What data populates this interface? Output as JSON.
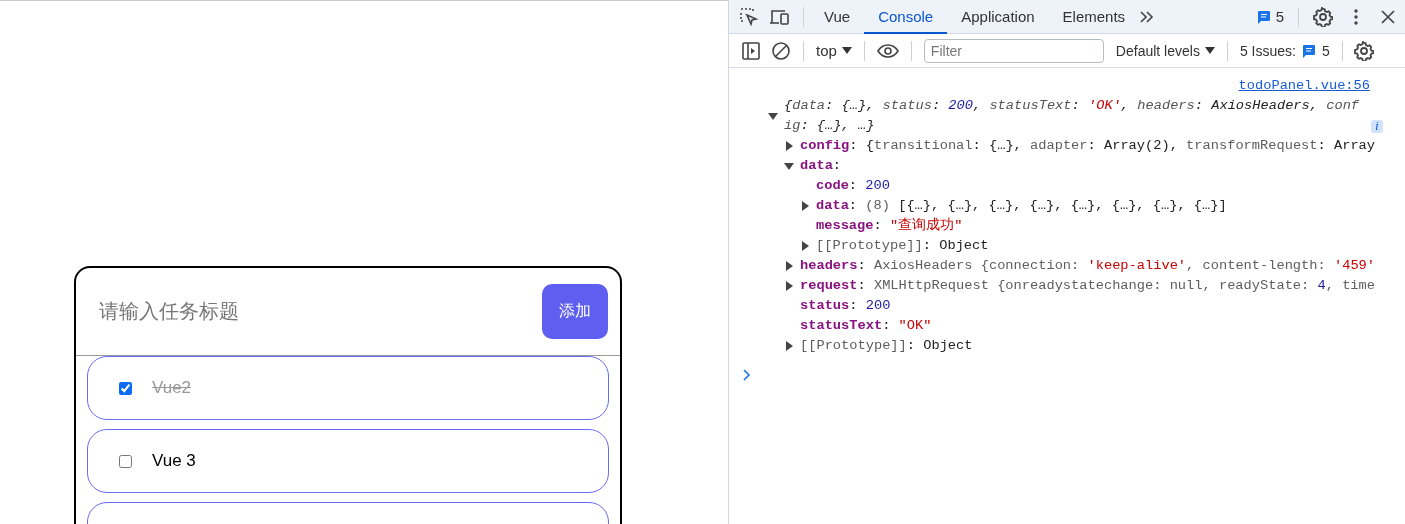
{
  "app": {
    "input": {
      "placeholder": "请输入任务标题"
    },
    "add_button": "添加",
    "todos": [
      {
        "kind": "task",
        "title": "Vue2",
        "checked": true
      },
      {
        "kind": "task",
        "title": "Vue 3",
        "checked": false
      },
      {
        "kind": "cut-off"
      }
    ]
  },
  "devtools": {
    "tabs": [
      {
        "label": "Vue",
        "selected": false
      },
      {
        "label": "Console",
        "selected": true
      },
      {
        "label": "Application",
        "selected": false
      },
      {
        "label": "Elements",
        "selected": false
      }
    ],
    "message_count": "5",
    "console_toolbar": {
      "context": "top",
      "filter_placeholder": "Filter",
      "levels": "Default levels",
      "issues_label": "5 Issues:",
      "issues_count": "5"
    },
    "console": {
      "source_link": "todoPanel.vue:56",
      "entries": [
        {
          "kind": "summary",
          "expanded": true,
          "badge": "i",
          "tokens": [
            {
              "text": "{",
              "kind": "text"
            },
            {
              "text": "data",
              "kind": "dim"
            },
            {
              "text": ": {…}, ",
              "kind": "text"
            },
            {
              "text": "status",
              "kind": "dim"
            },
            {
              "text": ": ",
              "kind": "text"
            },
            {
              "text": "200",
              "kind": "num"
            },
            {
              "text": ", ",
              "kind": "text"
            },
            {
              "text": "statusText",
              "kind": "dim"
            },
            {
              "text": ": ",
              "kind": "text"
            },
            {
              "text": "'OK'",
              "kind": "str"
            },
            {
              "text": ", ",
              "kind": "text"
            },
            {
              "text": "headers",
              "kind": "dim"
            },
            {
              "text": ": AxiosHeaders, ",
              "kind": "text"
            },
            {
              "text": "config",
              "kind": "dim"
            },
            {
              "text": ": {…}, …}",
              "kind": "text"
            }
          ],
          "children": [
            {
              "kind": "object",
              "expanded": false,
              "tokens": [
                {
                  "text": "config",
                  "kind": "key"
                },
                {
                  "text": ": {",
                  "kind": "text"
                },
                {
                  "text": "transitional",
                  "kind": "dim"
                },
                {
                  "text": ": {…}, ",
                  "kind": "text"
                },
                {
                  "text": "adapter",
                  "kind": "dim"
                },
                {
                  "text": ": Array(2), ",
                  "kind": "text"
                },
                {
                  "text": "transformRequest",
                  "kind": "dim"
                },
                {
                  "text": ": Array",
                  "kind": "text"
                }
              ]
            },
            {
              "kind": "object",
              "expanded": true,
              "tokens": [
                {
                  "text": "data",
                  "kind": "key"
                },
                {
                  "text": ":",
                  "kind": "text"
                }
              ],
              "children": [
                {
                  "kind": "value",
                  "tokens": [
                    {
                      "text": "code",
                      "kind": "key"
                    },
                    {
                      "text": ": ",
                      "kind": "text"
                    },
                    {
                      "text": "200",
                      "kind": "num"
                    }
                  ]
                },
                {
                  "kind": "object",
                  "expanded": false,
                  "tokens": [
                    {
                      "text": "data",
                      "kind": "key"
                    },
                    {
                      "text": ": ",
                      "kind": "text"
                    },
                    {
                      "text": "(8)",
                      "kind": "dim"
                    },
                    {
                      "text": " [{…}, {…}, {…}, {…}, {…}, {…}, {…}, {…}]",
                      "kind": "text"
                    }
                  ]
                },
                {
                  "kind": "value",
                  "tokens": [
                    {
                      "text": "message",
                      "kind": "key"
                    },
                    {
                      "text": ": ",
                      "kind": "text"
                    },
                    {
                      "text": "\"查询成功\"",
                      "kind": "str"
                    }
                  ]
                },
                {
                  "kind": "object",
                  "expanded": false,
                  "tokens": [
                    {
                      "text": "[[Prototype]]",
                      "kind": "dim"
                    },
                    {
                      "text": ": Object",
                      "kind": "text"
                    }
                  ]
                }
              ]
            },
            {
              "kind": "object",
              "expanded": false,
              "tokens": [
                {
                  "text": "headers",
                  "kind": "key"
                },
                {
                  "text": ": ",
                  "kind": "text"
                },
                {
                  "text": "AxiosHeaders {",
                  "kind": "dim"
                },
                {
                  "text": "connection: ",
                  "kind": "dim"
                },
                {
                  "text": "'keep-alive'",
                  "kind": "str"
                },
                {
                  "text": ", content-length: ",
                  "kind": "dim"
                },
                {
                  "text": "'459'",
                  "kind": "str"
                }
              ]
            },
            {
              "kind": "object",
              "expanded": false,
              "tokens": [
                {
                  "text": "request",
                  "kind": "key"
                },
                {
                  "text": ": ",
                  "kind": "text"
                },
                {
                  "text": "XMLHttpRequest {onreadystatechange: ",
                  "kind": "dim"
                },
                {
                  "text": "null",
                  "kind": "dim"
                },
                {
                  "text": ", readyState: ",
                  "kind": "dim"
                },
                {
                  "text": "4",
                  "kind": "num"
                },
                {
                  "text": ", time",
                  "kind": "dim"
                }
              ]
            },
            {
              "kind": "value",
              "tokens": [
                {
                  "text": "status",
                  "kind": "key"
                },
                {
                  "text": ": ",
                  "kind": "text"
                },
                {
                  "text": "200",
                  "kind": "num"
                }
              ]
            },
            {
              "kind": "value",
              "tokens": [
                {
                  "text": "statusText",
                  "kind": "key"
                },
                {
                  "text": ": ",
                  "kind": "text"
                },
                {
                  "text": "\"OK\"",
                  "kind": "str"
                }
              ]
            },
            {
              "kind": "object",
              "expanded": false,
              "tokens": [
                {
                  "text": "[[Prototype]]",
                  "kind": "dim"
                },
                {
                  "text": ": Object",
                  "kind": "text"
                }
              ]
            }
          ]
        }
      ]
    }
  }
}
